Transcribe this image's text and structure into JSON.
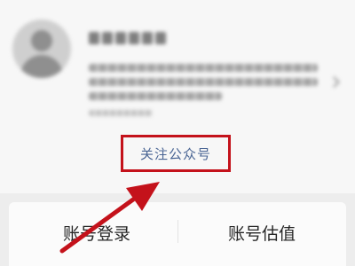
{
  "profile": {
    "avatar_icon": "person-avatar-icon",
    "name_blurred": true,
    "description_blurred": true,
    "chevron_icon": "chevron-right-icon"
  },
  "follow_button": {
    "label": "关注公众号",
    "highlight_color": "#c4121b",
    "text_color": "#4a6594"
  },
  "bottom_actions": [
    {
      "label": "账号登录"
    },
    {
      "label": "账号估值"
    }
  ],
  "annotation": {
    "type": "arrow",
    "color": "#c4121b"
  }
}
